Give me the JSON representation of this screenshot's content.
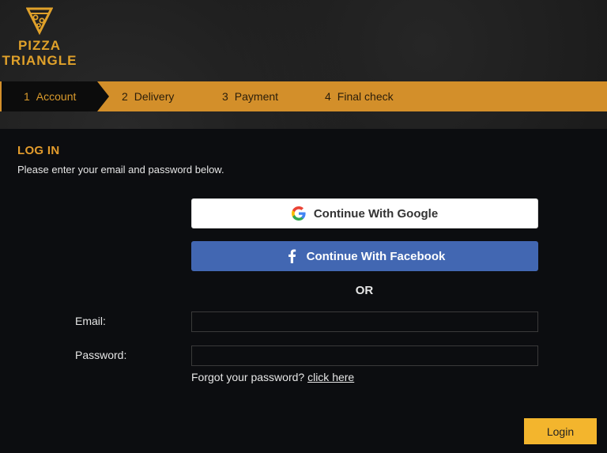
{
  "brand": {
    "line1": "PIZZA",
    "line2": "TRIANGLE",
    "icon": "pizza-slice-logo-icon",
    "color": "#e0a12a"
  },
  "steps": [
    {
      "num": "1",
      "label": "Account",
      "active": true
    },
    {
      "num": "2",
      "label": "Delivery",
      "active": false
    },
    {
      "num": "3",
      "label": "Payment",
      "active": false
    },
    {
      "num": "4",
      "label": "Final check",
      "active": false
    }
  ],
  "login": {
    "title": "LOG IN",
    "subtitle": "Please enter your email and password below.",
    "google_label": "Continue With Google",
    "facebook_label": "Continue With Facebook",
    "or_label": "OR",
    "email_label": "Email:",
    "email_value": "",
    "password_label": "Password:",
    "password_value": "",
    "forgot_text": "Forgot your password?",
    "forgot_link": "click here",
    "login_button": "Login"
  },
  "colors": {
    "accent": "#d38f2a",
    "title": "#e39c2c",
    "facebook": "#4267b2",
    "login_button": "#f3b52d"
  }
}
